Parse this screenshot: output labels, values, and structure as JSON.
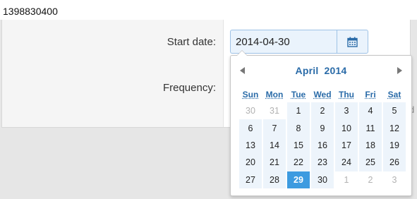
{
  "timestamp": "1398830400",
  "form": {
    "start_date_label": "Start date:",
    "start_date_value": "2014-04-30",
    "frequency_label": "Frequency:",
    "frequency_partial_text": "d"
  },
  "datepicker": {
    "month": "April",
    "year": "2014",
    "weekdays": [
      "Sun",
      "Mon",
      "Tue",
      "Wed",
      "Thu",
      "Fri",
      "Sat"
    ],
    "weeks": [
      [
        "30",
        "31",
        "1",
        "2",
        "3",
        "4",
        "5"
      ],
      [
        "6",
        "7",
        "8",
        "9",
        "10",
        "11",
        "12"
      ],
      [
        "13",
        "14",
        "15",
        "16",
        "17",
        "18",
        "19"
      ],
      [
        "20",
        "21",
        "22",
        "23",
        "24",
        "25",
        "26"
      ],
      [
        "27",
        "28",
        "29",
        "30",
        "1",
        "2",
        "3"
      ]
    ],
    "selected_day": "29",
    "accent_color": "#3d9be0",
    "title_color": "#2a6ba8"
  },
  "icons": {
    "calendar": "calendar-icon",
    "prev": "triangle-left-icon",
    "next": "triangle-right-icon"
  }
}
